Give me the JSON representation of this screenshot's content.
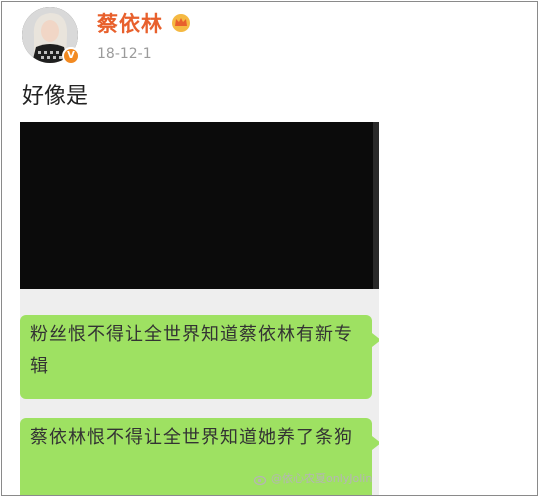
{
  "post": {
    "author": "蔡依林",
    "date": "18-12-1",
    "text": "好像是",
    "verified_badge": "V",
    "avatar_icon": "avatar-photo",
    "crown_icon": "crown-icon"
  },
  "image": {
    "messages": [
      {
        "text": "粉丝恨不得让全世界知道蔡依林有新专辑"
      },
      {
        "text": "蔡依林恨不得让全世界知道她养了条狗"
      }
    ],
    "watermark": "@依心农夏onlyJolin",
    "bubble_color": "#9ee162"
  },
  "colors": {
    "author_name": "#e8602c",
    "badge": "#f28a22"
  }
}
